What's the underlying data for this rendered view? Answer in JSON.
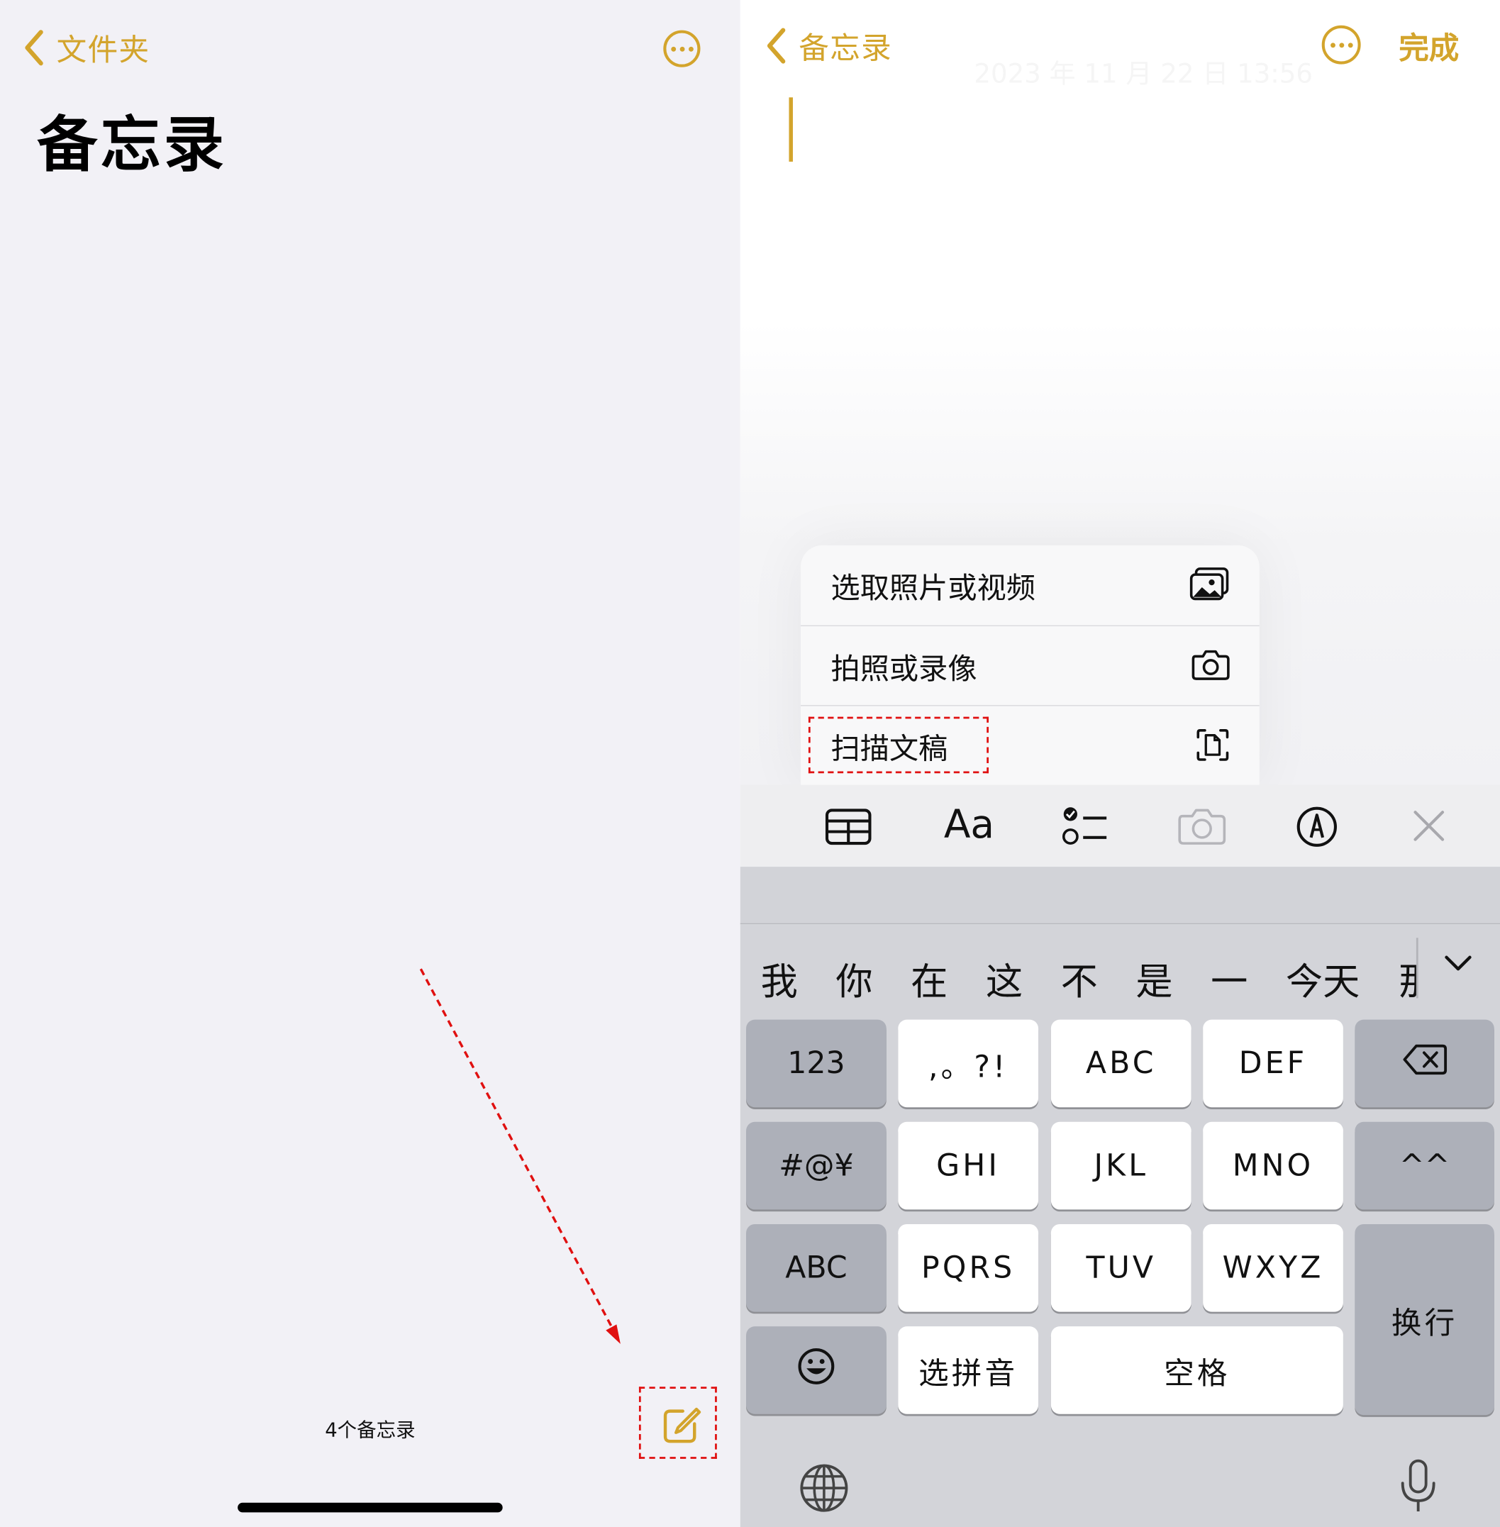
{
  "colors": {
    "accent": "#d3a42c",
    "highlight": "#e01010",
    "keyboard_bg": "#d3d4d9"
  },
  "left": {
    "back_label": "文件夹",
    "title": "备忘录",
    "note_count": "4个备忘录",
    "icons": {
      "back": "chevron-left-icon",
      "more": "ellipsis-circle-icon",
      "compose": "compose-icon"
    }
  },
  "right": {
    "back_label": "备忘录",
    "done_label": "完成",
    "date_ghost": "2023 年 11 月 22 日 13:56",
    "attach_menu": [
      {
        "label": "选取照片或视频",
        "icon": "photo-library-icon"
      },
      {
        "label": "拍照或录像",
        "icon": "camera-icon"
      },
      {
        "label": "扫描文稿",
        "icon": "doc-scan-icon"
      }
    ],
    "toolbar": [
      {
        "icon": "table-icon"
      },
      {
        "label": "Aa",
        "icon": "text-format-icon"
      },
      {
        "icon": "checklist-icon"
      },
      {
        "icon": "camera-icon"
      },
      {
        "icon": "markup-icon"
      },
      {
        "icon": "close-icon"
      }
    ],
    "keyboard": {
      "candidates": [
        "我",
        "你",
        "在",
        "这",
        "不",
        "是",
        "一",
        "今天",
        "那"
      ],
      "rows": [
        [
          "123",
          ",。?!",
          "ABC",
          "DEF",
          "delete"
        ],
        [
          "#@¥",
          "GHI",
          "JKL",
          "MNO",
          "^^"
        ],
        [
          "ABC",
          "PQRS",
          "TUV",
          "WXYZ",
          "换行"
        ],
        [
          "emoji",
          "选拼音",
          "空格"
        ]
      ],
      "labels": {
        "k123": "123",
        "punct": ",。?!",
        "abc2": "ABC",
        "def": "DEF",
        "sym": "#@¥",
        "ghi": "GHI",
        "jkl": "JKL",
        "mno": "MNO",
        "kao": "^^",
        "abc": "ABC",
        "pqrs": "PQRS",
        "tuv": "TUV",
        "wxyz": "WXYZ",
        "return": "换行",
        "pinyin": "选拼音",
        "space": "空格"
      }
    }
  }
}
